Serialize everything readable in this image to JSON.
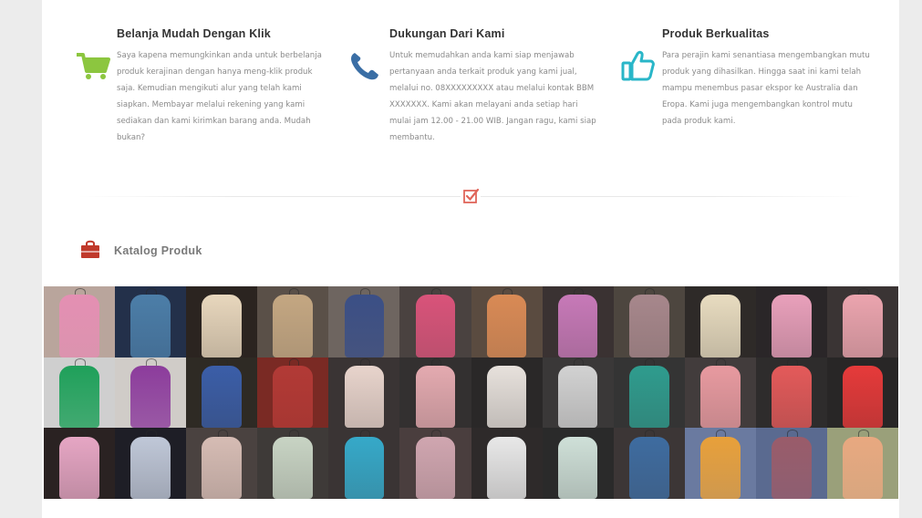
{
  "features": [
    {
      "title": "Belanja Mudah Dengan Klik",
      "text": "Saya kapena memungkinkan anda untuk berbelanja produk kerajinan dengan hanya meng-klik produk saja. Kemudian mengikuti alur yang telah kami siapkan. Membayar melalui rekening yang kami sediakan dan kami kirimkan barang anda. Mudah bukan?",
      "icon": "shopping-cart-icon",
      "icon_color": "#8cc63f"
    },
    {
      "title": "Dukungan Dari Kami",
      "text": "Untuk memudahkan anda kami siap menjawab pertanyaan anda terkait produk yang kami jual, melalui no. 08XXXXXXXXX atau melalui kontak BBM XXXXXXX. Kami akan melayani anda setiap hari mulai jam 12.00 - 21.00 WIB. Jangan ragu, kami siap membantu.",
      "icon": "phone-icon",
      "icon_color": "#3a6ea5"
    },
    {
      "title": "Produk Berkualitas",
      "text": "Para perajin kami senantiasa mengembangkan mutu produk yang dihasilkan. Hingga saat ini kami telah mampu menembus pasar ekspor ke Australia dan Eropa. Kami juga mengembangkan kontrol mutu pada produk kami.",
      "icon": "thumbs-up-icon",
      "icon_color": "#29b6c8"
    }
  ],
  "divider_icon": "check-square-icon",
  "accent": "#e0655a",
  "catalog": {
    "label": "Katalog Produk",
    "icon": "shopping-bag-icon",
    "icon_color": "#c0392b"
  },
  "gallery": {
    "icon": "clothing-photo",
    "tiles": [
      {
        "bg": "#b9a59c",
        "color": "#e48fb3"
      },
      {
        "bg": "#23304a",
        "color": "#4c7ea8"
      },
      {
        "bg": "#2b2420",
        "color": "#e8d7bd"
      },
      {
        "bg": "#5a5048",
        "color": "#c4a782"
      },
      {
        "bg": "#6e6560",
        "color": "#3b4f86"
      },
      {
        "bg": "#4a4240",
        "color": "#d9537a"
      },
      {
        "bg": "#5a4b40",
        "color": "#d98a55"
      },
      {
        "bg": "#3a3232",
        "color": "#c779b8"
      },
      {
        "bg": "#4d463f",
        "color": "#a7878c"
      },
      {
        "bg": "#2e2a28",
        "color": "#e8dcc0"
      },
      {
        "bg": "#2a2628",
        "color": "#e9a0bb"
      },
      {
        "bg": "#3a3434",
        "color": "#eba4ae"
      },
      {
        "bg": "#cfcfcf",
        "color": "#1fa05a"
      },
      {
        "bg": "#d0ccc8",
        "color": "#8c3c9c"
      },
      {
        "bg": "#2e2a24",
        "color": "#3b5ea8"
      },
      {
        "bg": "#7a2a24",
        "color": "#b23a36"
      },
      {
        "bg": "#3a3434",
        "color": "#e8d4cc"
      },
      {
        "bg": "#333030",
        "color": "#e4aab0"
      },
      {
        "bg": "#2a2828",
        "color": "#e7e1dc"
      },
      {
        "bg": "#3a3838",
        "color": "#d2d2d2"
      },
      {
        "bg": "#343434",
        "color": "#2f9c8e"
      },
      {
        "bg": "#423c3c",
        "color": "#e89aa0"
      },
      {
        "bg": "#2e2c2c",
        "color": "#e45a5a"
      },
      {
        "bg": "#282626",
        "color": "#e63a3a"
      },
      {
        "bg": "#2a2222",
        "color": "#e6a6c4"
      },
      {
        "bg": "#1e1e26",
        "color": "#c0c8d8"
      },
      {
        "bg": "#4a4240",
        "color": "#d6bcb4"
      },
      {
        "bg": "#3e3a38",
        "color": "#c8d4c4"
      },
      {
        "bg": "#3a3434",
        "color": "#36a9c9"
      },
      {
        "bg": "#4a3e3e",
        "color": "#d0a6b0"
      },
      {
        "bg": "#2e2a2a",
        "color": "#e8e8e8"
      },
      {
        "bg": "#2a2a2a",
        "color": "#cfe0d8"
      },
      {
        "bg": "#3c3636",
        "color": "#3e6ca0"
      },
      {
        "bg": "#6a7aa0",
        "color": "#e8a03a"
      },
      {
        "bg": "#5a6a90",
        "color": "#9a5c6a"
      },
      {
        "bg": "#9aa07a",
        "color": "#e8a880"
      }
    ]
  }
}
